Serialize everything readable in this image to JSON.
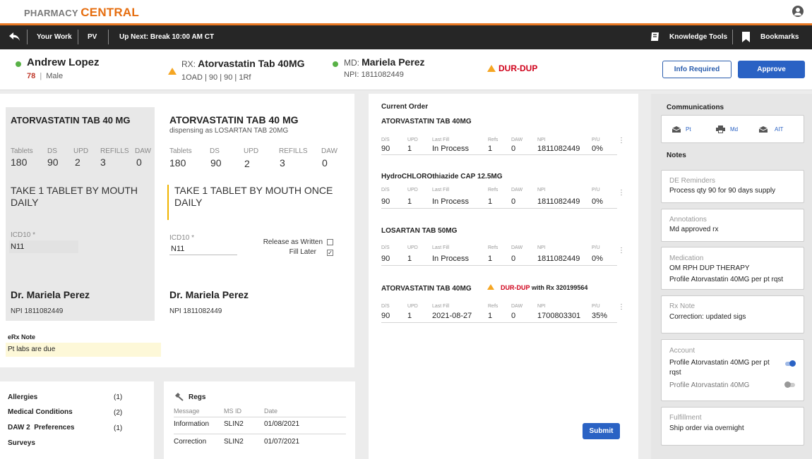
{
  "app": {
    "brand_part1": "PHARMACY",
    "brand_part2": "CENTRAL"
  },
  "nav": {
    "your_work": "Your Work",
    "pv": "PV",
    "up_next": "Up Next: Break 10:00 AM CT",
    "knowledge_tools": "Knowledge Tools",
    "bookmarks": "Bookmarks"
  },
  "patient": {
    "name": "Andrew Lopez",
    "age": "78",
    "sep": "|",
    "sex": "Male"
  },
  "rx": {
    "prefix": "RX:",
    "drug": "Atorvastatin Tab 40MG",
    "details": "1OAD | 90 | 90 | 1Rf"
  },
  "md": {
    "prefix": "MD:",
    "name": "Mariela Perez",
    "npi": "NPI: 1811082449"
  },
  "alert": {
    "label": "DUR-DUP"
  },
  "actions": {
    "info_required": "Info Required",
    "approve": "Approve"
  },
  "original": {
    "drug": "ATORVASTATIN TAB 40 MG",
    "labels": {
      "tablets": "Tablets",
      "ds": "DS",
      "upd": "UPD",
      "refills": "REFILLS",
      "daw": "DAW"
    },
    "values": {
      "tablets": "180",
      "ds": "90",
      "upd": "2",
      "refills": "3",
      "daw": "0"
    },
    "sig": "TAKE 1 TABLET BY MOUTH DAILY",
    "icd_label": "ICD10 *",
    "icd": "N11",
    "doctor": "Dr. Mariela Perez",
    "npi": "NPI 1811082449"
  },
  "dispensed": {
    "drug": "ATORVASTATIN TAB 40 MG",
    "note": "dispensing as LOSARTAN TAB 20MG",
    "labels": {
      "tablets": "Tablets",
      "ds": "DS",
      "upd": "UPD",
      "refills": "REFILLS",
      "daw": "DAW"
    },
    "values": {
      "tablets": "180",
      "ds": "90",
      "upd": "2",
      "refills": "3",
      "daw": "0"
    },
    "sig": "TAKE 1 TABLET BY MOUTH ONCE DAILY",
    "icd_label": "ICD10 *",
    "icd": "N11",
    "release_label": "Release as Written",
    "release_checked": false,
    "fill_later_label": "Fill Later",
    "fill_later_checked": true,
    "doctor": "Dr. Mariela Perez",
    "npi": "NPI 1811082449"
  },
  "erx": {
    "label": "eRx Note",
    "text": "Pt labs are due"
  },
  "history": [
    {
      "label": "Allergies",
      "count": "(1)"
    },
    {
      "label": "Medical Conditions",
      "count": "(2)"
    },
    {
      "label": "DAW 2  Preferences",
      "count": "(1)"
    },
    {
      "label": "Surveys",
      "count": ""
    }
  ],
  "regs": {
    "title": "Regs",
    "headers": [
      "Message",
      "MS ID",
      "Date"
    ],
    "rows": [
      [
        "Information",
        "SLIN2",
        "01/08/2021"
      ],
      [
        "Correction",
        "SLIN2",
        "01/07/2021"
      ]
    ]
  },
  "current_order": {
    "title": "Current Order",
    "col_labels": [
      "D/S",
      "UPD",
      "Last Fill",
      "Refs",
      "DAW",
      "NPI",
      "P/U"
    ],
    "orders": [
      {
        "drug": "ATORVASTATIN TAB 40MG",
        "alert": "",
        "alert_suffix": "",
        "values": [
          "90",
          "1",
          "In Process",
          "1",
          "0",
          "1811082449",
          "0%"
        ]
      },
      {
        "drug": "HydroCHLOROthiazide CAP 12.5MG",
        "alert": "",
        "alert_suffix": "",
        "values": [
          "90",
          "1",
          "In Process",
          "1",
          "0",
          "1811082449",
          "0%"
        ]
      },
      {
        "drug": "LOSARTAN TAB 50MG",
        "alert": "",
        "alert_suffix": "",
        "values": [
          "90",
          "1",
          "In Process",
          "1",
          "0",
          "1811082449",
          "0%"
        ]
      },
      {
        "drug": "ATORVASTATIN TAB 40MG",
        "alert": "DUR-DUP",
        "alert_suffix": " with Rx 320199564",
        "values": [
          "90",
          "1",
          "2021-08-27",
          "1",
          "0",
          "1700803301",
          "35%"
        ]
      }
    ],
    "submit": "Submit"
  },
  "sidebar": {
    "communications_title": "Communications",
    "comm": [
      {
        "label": "Pt"
      },
      {
        "label": "Md"
      },
      {
        "label": "AIT"
      }
    ],
    "notes_title": "Notes",
    "de_reminders": {
      "label": "DE Reminders",
      "text": "Process qty 90 for 90 days supply"
    },
    "annotations": {
      "label": "Annotations",
      "text": "Md approved rx"
    },
    "medication": {
      "label": "Medication",
      "line1": "OM RPH DUP THERAPY",
      "line2": "Profile Atorvastatin 40MG per pt rqst"
    },
    "rx_note": {
      "label": "Rx Note",
      "text": "Correction: updated sigs"
    },
    "account": {
      "label": "Account",
      "item1": "Profile Atorvastatin 40MG per pt rqst",
      "item1_on": true,
      "item2": "Profile Atorvastatin 40MG",
      "item2_on": false
    },
    "fulfillment": {
      "label": "Fulfillment",
      "text": "Ship order via overnight"
    }
  },
  "colors": {
    "accent_orange": "#e87722",
    "primary_blue": "#2a62c4",
    "alert_red": "#d0021b",
    "warn_yellow": "#f5a623",
    "ok_green": "#58b146"
  }
}
